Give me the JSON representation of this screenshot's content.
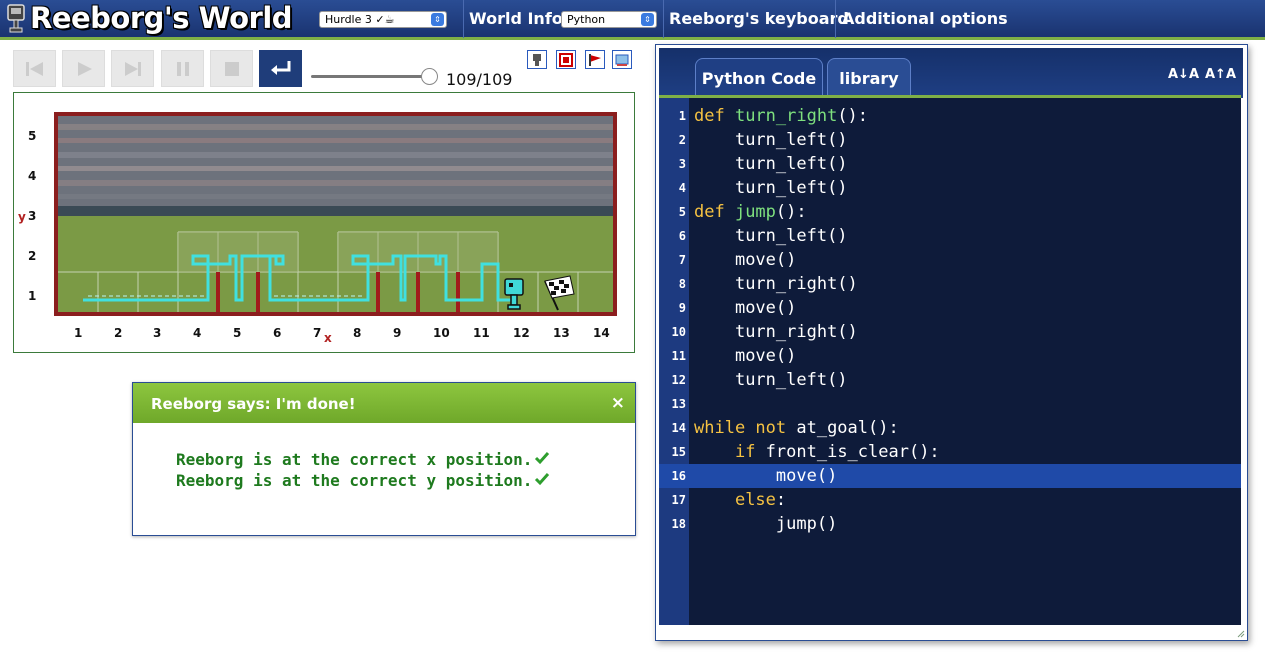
{
  "header": {
    "title": "Reeborg's World",
    "world_select": "Hurdle 3 ✓☕",
    "world_info": "World Info",
    "language_select": "Python",
    "keyboard": "Reeborg's keyboard",
    "additional_options": "Additional options"
  },
  "controls": {
    "step_counter": "109/109",
    "slider_progress": 1.0
  },
  "world": {
    "y_ticks": [
      "5",
      "4",
      "3",
      "2",
      "1"
    ],
    "x_ticks": [
      "1",
      "2",
      "3",
      "4",
      "5",
      "6",
      "7",
      "8",
      "9",
      "10",
      "11",
      "12",
      "13",
      "14"
    ],
    "x_axis_letter": "x",
    "y_axis_letter": "y"
  },
  "dialog": {
    "title": "Reeborg says: I'm done!",
    "close": "×",
    "lines": [
      "Reeborg is at the correct x position.",
      "Reeborg is at the correct y position."
    ]
  },
  "editor": {
    "tabs": [
      "Python Code",
      "library"
    ],
    "font_decrease": "A↓A",
    "font_increase": "A↑A",
    "active_line": 16,
    "code": [
      {
        "n": "1",
        "indent": "",
        "parts": [
          [
            "kw",
            "def "
          ],
          [
            "fn",
            "turn_right"
          ],
          [
            "",
            "():"
          ]
        ]
      },
      {
        "n": "2",
        "indent": "    ",
        "parts": [
          [
            "",
            "turn_left()"
          ]
        ]
      },
      {
        "n": "3",
        "indent": "    ",
        "parts": [
          [
            "",
            "turn_left()"
          ]
        ]
      },
      {
        "n": "4",
        "indent": "    ",
        "parts": [
          [
            "",
            "turn_left()"
          ]
        ]
      },
      {
        "n": "5",
        "indent": "",
        "parts": [
          [
            "kw",
            "def "
          ],
          [
            "fn",
            "jump"
          ],
          [
            "",
            "():"
          ]
        ]
      },
      {
        "n": "6",
        "indent": "    ",
        "parts": [
          [
            "",
            "turn_left()"
          ]
        ]
      },
      {
        "n": "7",
        "indent": "    ",
        "parts": [
          [
            "",
            "move()"
          ]
        ]
      },
      {
        "n": "8",
        "indent": "    ",
        "parts": [
          [
            "",
            "turn_right()"
          ]
        ]
      },
      {
        "n": "9",
        "indent": "    ",
        "parts": [
          [
            "",
            "move()"
          ]
        ]
      },
      {
        "n": "10",
        "indent": "    ",
        "parts": [
          [
            "",
            "turn_right()"
          ]
        ]
      },
      {
        "n": "11",
        "indent": "    ",
        "parts": [
          [
            "",
            "move()"
          ]
        ]
      },
      {
        "n": "12",
        "indent": "    ",
        "parts": [
          [
            "",
            "turn_left()"
          ]
        ]
      },
      {
        "n": "13",
        "indent": "",
        "parts": []
      },
      {
        "n": "14",
        "indent": "",
        "parts": [
          [
            "kw",
            "while not "
          ],
          [
            "",
            "at_goal():"
          ]
        ]
      },
      {
        "n": "15",
        "indent": "    ",
        "parts": [
          [
            "kw",
            "if "
          ],
          [
            "",
            "front_is_clear():"
          ]
        ]
      },
      {
        "n": "16",
        "indent": "        ",
        "parts": [
          [
            "",
            "move()"
          ]
        ]
      },
      {
        "n": "17",
        "indent": "    ",
        "parts": [
          [
            "kw",
            "else"
          ],
          [
            "",
            ":"
          ]
        ]
      },
      {
        "n": "18",
        "indent": "        ",
        "parts": [
          [
            "",
            "jump()"
          ]
        ]
      }
    ]
  }
}
